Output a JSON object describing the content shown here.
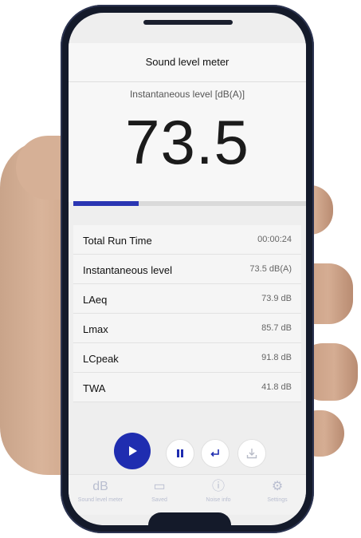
{
  "app": {
    "title": "Sound level meter"
  },
  "level": {
    "label": "Instantaneous level [dB(A)]",
    "value": "73.5",
    "progress_fraction": 0.28
  },
  "stats": [
    {
      "label": "Total Run Time",
      "value": "00:00:24"
    },
    {
      "label": "Instantaneous level",
      "value": "73.5 dB(A)"
    },
    {
      "label": "LAeq",
      "value": "73.9 dB"
    },
    {
      "label": "Lmax",
      "value": "85.7 dB"
    },
    {
      "label": "LCpeak",
      "value": "91.8 dB"
    },
    {
      "label": "TWA",
      "value": "41.8 dB"
    }
  ],
  "controls": {
    "play_icon": "play-icon",
    "pause_icon": "pause-icon",
    "reset_icon": "return-icon",
    "download_icon": "download-icon"
  },
  "tabs": [
    {
      "label": "Sound level meter",
      "icon_text": "dB"
    },
    {
      "label": "Saved",
      "icon_text": "▭"
    },
    {
      "label": "Noise info",
      "icon_text": "ⓘ"
    },
    {
      "label": "Settings",
      "icon_text": "⚙"
    }
  ],
  "colors": {
    "accent": "#1f2db0",
    "tab_inactive": "#b9bed0"
  }
}
